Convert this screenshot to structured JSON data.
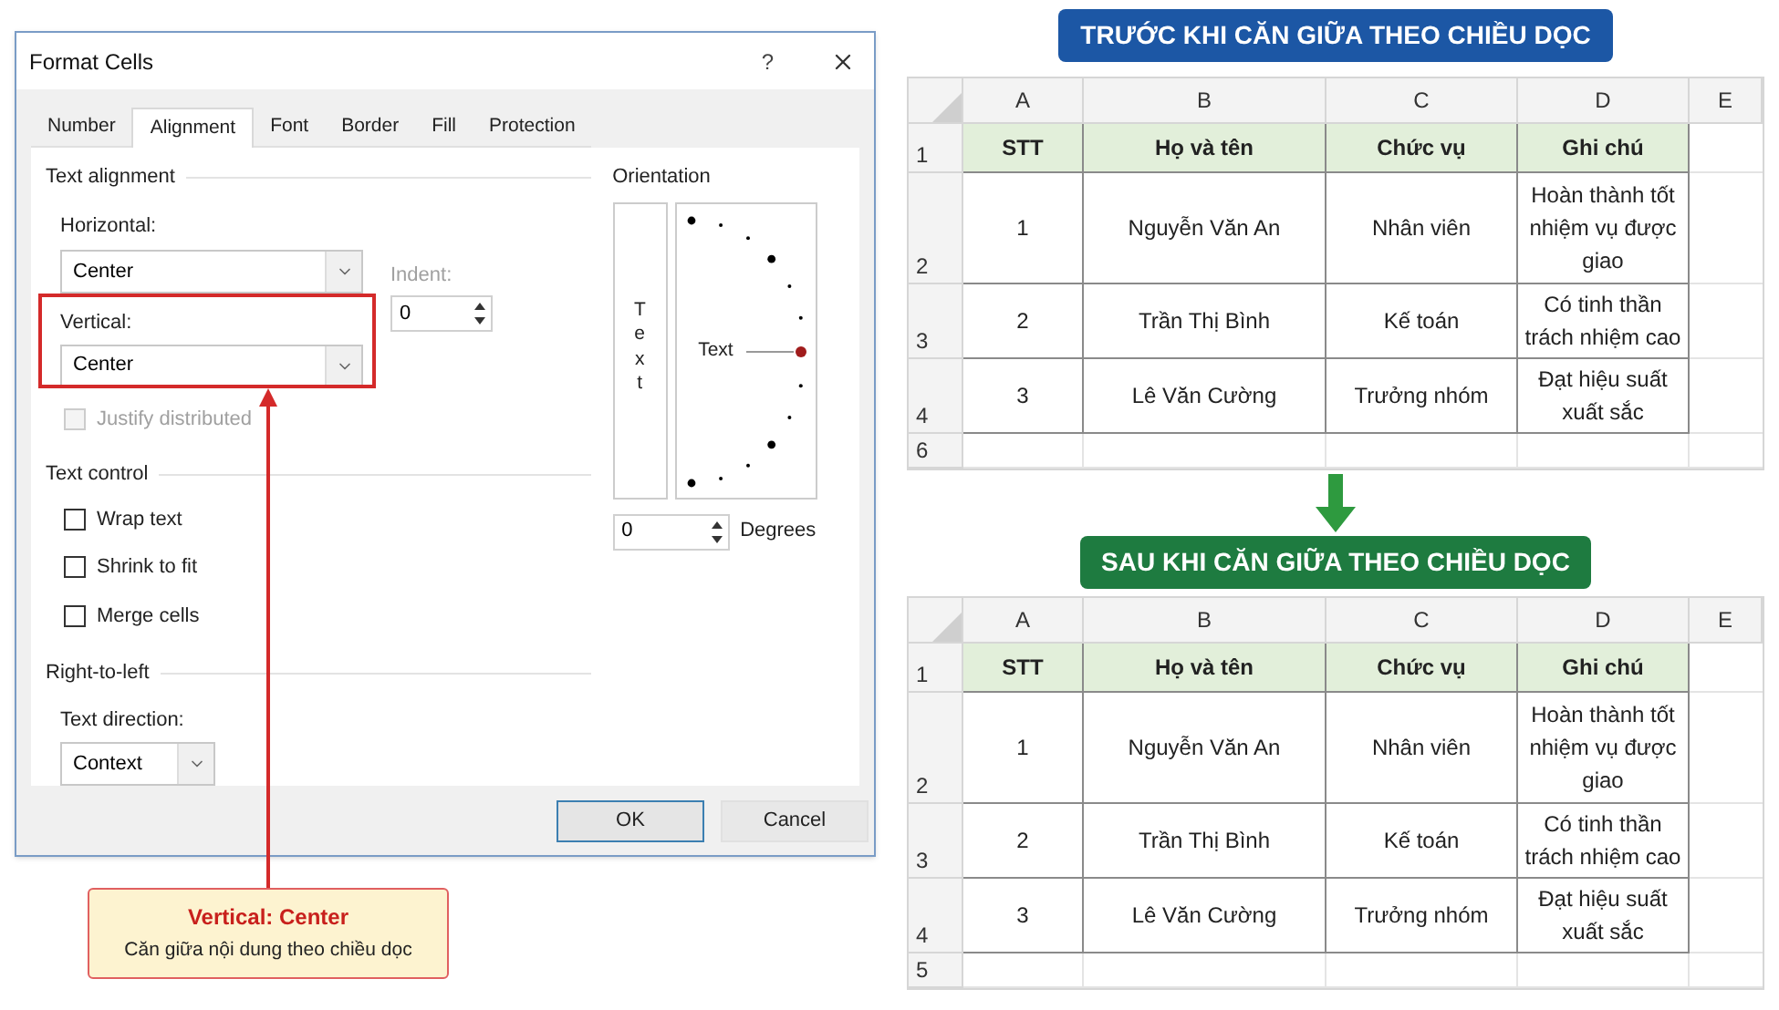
{
  "dialog": {
    "title": "Format Cells",
    "help": "?",
    "tabs": [
      {
        "label": "Number",
        "selected": false
      },
      {
        "label": "Alignment",
        "selected": true
      },
      {
        "label": "Font",
        "selected": false
      },
      {
        "label": "Border",
        "selected": false
      },
      {
        "label": "Fill",
        "selected": false
      },
      {
        "label": "Protection",
        "selected": false
      }
    ],
    "text_alignment": {
      "heading": "Text alignment",
      "horizontal_label": "Horizontal:",
      "horizontal_value": "Center",
      "indent_label": "Indent:",
      "indent_value": "0",
      "vertical_label": "Vertical:",
      "vertical_value": "Center",
      "vertical_highlighted": true,
      "justify_label": "Justify distributed",
      "justify_checked": false,
      "justify_disabled": true
    },
    "text_control": {
      "heading": "Text control",
      "options": [
        {
          "label": "Wrap text",
          "checked": false
        },
        {
          "label": "Shrink to fit",
          "checked": false
        },
        {
          "label": "Merge cells",
          "checked": false
        }
      ]
    },
    "right_to_left": {
      "heading": "Right-to-left",
      "direction_label": "Text direction:",
      "direction_value": "Context"
    },
    "orientation": {
      "heading": "Orientation",
      "vertical_text": "Text",
      "dial_text": "Text",
      "degrees_value": "0",
      "degrees_label": "Degrees"
    },
    "buttons": [
      {
        "label": "OK",
        "default": true
      },
      {
        "label": "Cancel",
        "default": false
      }
    ]
  },
  "callout": {
    "title": "Vertical: Center",
    "text": "Căn giữa nội dung theo chiều dọc"
  },
  "sheets": [
    {
      "title": "TRƯỚC KHI CĂN GIỮA THEO CHIỀU DỌC",
      "color": "#1c57a5",
      "columns": [
        "A",
        "B",
        "C",
        "D",
        "E"
      ],
      "rows": [
        {
          "number": "1",
          "kind": "header",
          "cells": [
            "STT",
            "Họ và tên",
            "Chức vụ",
            "Ghi chú"
          ]
        },
        {
          "number": "2",
          "kind": "data",
          "cells": [
            "1",
            "Nguyễn Văn An",
            "Nhân viên",
            "Hoàn thành tốt nhiệm vụ được giao"
          ]
        },
        {
          "number": "3",
          "kind": "data",
          "cells": [
            "2",
            "Trần Thị Bình",
            "Kế toán",
            "Có tinh thần trách nhiệm cao"
          ]
        },
        {
          "number": "4",
          "kind": "data",
          "cells": [
            "3",
            "Lê Văn Cường",
            "Trưởng nhóm",
            "Đạt hiệu suất xuất sắc"
          ]
        },
        {
          "number": "6",
          "kind": "empty",
          "cells": []
        }
      ]
    },
    {
      "title": "SAU KHI CĂN GIỮA THEO CHIỀU DỌC",
      "color": "#1e7b40",
      "columns": [
        "A",
        "B",
        "C",
        "D",
        "E"
      ],
      "rows": [
        {
          "number": "1",
          "kind": "header",
          "cells": [
            "STT",
            "Họ và tên",
            "Chức vụ",
            "Ghi chú"
          ]
        },
        {
          "number": "2",
          "kind": "data",
          "cells": [
            "1",
            "Nguyễn Văn An",
            "Nhân viên",
            "Hoàn thành tốt nhiệm vụ được giao"
          ]
        },
        {
          "number": "3",
          "kind": "data",
          "cells": [
            "2",
            "Trần Thị Bình",
            "Kế toán",
            "Có tinh thần trách nhiệm cao"
          ]
        },
        {
          "number": "4",
          "kind": "data",
          "cells": [
            "3",
            "Lê Văn Cường",
            "Trưởng nhóm",
            "Đạt hiệu suất xuất sắc"
          ]
        },
        {
          "number": "5",
          "kind": "empty",
          "cells": []
        }
      ]
    }
  ]
}
